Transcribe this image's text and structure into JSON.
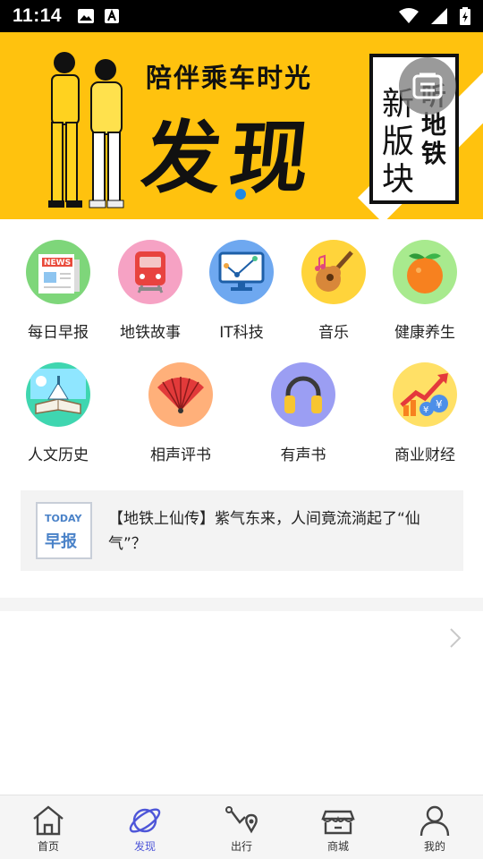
{
  "status_bar": {
    "time": "11:14"
  },
  "banner": {
    "tagline": "陪伴乘车时光",
    "title": "发现",
    "box_col1": "新版块",
    "box_col2": "听地铁"
  },
  "categories": [
    {
      "label": "每日早报",
      "icon": "news-icon",
      "bg": "#7ed67a"
    },
    {
      "label": "地铁故事",
      "icon": "metro-train-icon",
      "bg": "#f6a2c4"
    },
    {
      "label": "IT科技",
      "icon": "monitor-icon",
      "bg": "#6ea8f0"
    },
    {
      "label": "音乐",
      "icon": "guitar-icon",
      "bg": "#ffd43b"
    },
    {
      "label": "健康养生",
      "icon": "orange-fruit-icon",
      "bg": "#a8ea8e"
    },
    {
      "label": "人文历史",
      "icon": "book-landscape-icon",
      "bg": "#3fd6b0"
    },
    {
      "label": "相声评书",
      "icon": "folding-fan-icon",
      "bg": "#ffb07a"
    },
    {
      "label": "有声书",
      "icon": "headphones-icon",
      "bg": "#9b9ef3"
    },
    {
      "label": "商业财经",
      "icon": "finance-chart-icon",
      "bg": "#ffe066"
    }
  ],
  "news": {
    "thumb_en": "TODAY",
    "thumb_cn": "早报",
    "text": "【地铁上仙传】紫气东来，人间竟流淌起了“仙气”？"
  },
  "tabbar": [
    {
      "label": "首页",
      "icon": "home-icon",
      "active": false
    },
    {
      "label": "发现",
      "icon": "planet-icon",
      "active": true
    },
    {
      "label": "出行",
      "icon": "route-icon",
      "active": false
    },
    {
      "label": "商城",
      "icon": "store-icon",
      "active": false
    },
    {
      "label": "我的",
      "icon": "user-icon",
      "active": false
    }
  ],
  "colors": {
    "accent": "#4e56d8",
    "banner": "#ffc20e",
    "dot": "#1e88e5"
  }
}
